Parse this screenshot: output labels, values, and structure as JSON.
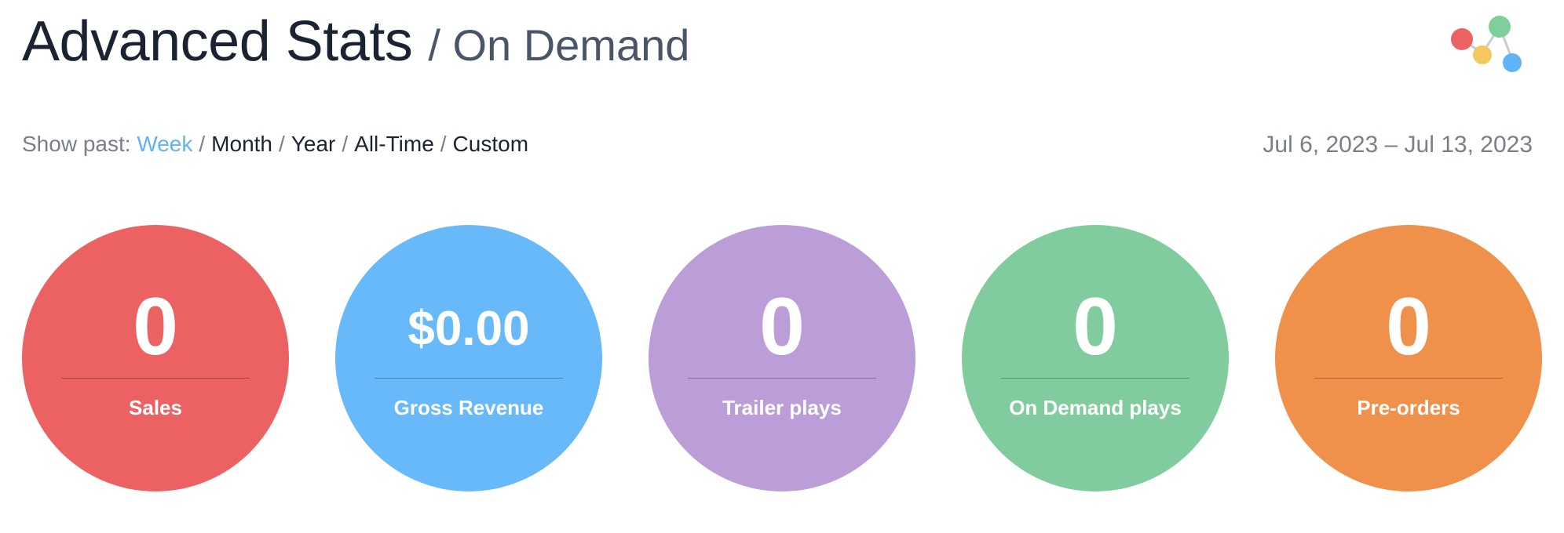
{
  "header": {
    "title": "Advanced Stats",
    "subtitle": "/ On Demand"
  },
  "logo": {
    "icon": "network-nodes-logo",
    "colors": [
      "#ec6263",
      "#f5c85e",
      "#7fcf9c",
      "#5fb4f7"
    ]
  },
  "filter": {
    "prefix": "Show past:",
    "options": [
      {
        "label": "Week",
        "active": true
      },
      {
        "label": "Month",
        "active": false
      },
      {
        "label": "Year",
        "active": false
      },
      {
        "label": "All-Time",
        "active": false
      },
      {
        "label": "Custom",
        "active": false
      }
    ],
    "separator": "/",
    "active_color": "#5fb4f1"
  },
  "date_range": "Jul 6, 2023 – Jul 13, 2023",
  "stats": [
    {
      "value": "0",
      "label": "Sales",
      "color": "#ec6263"
    },
    {
      "value": "$0.00",
      "label": "Gross Revenue",
      "color": "#67b9fa"
    },
    {
      "value": "0",
      "label": "Trailer plays",
      "color": "#bb9ed8"
    },
    {
      "value": "0",
      "label": "On Demand plays",
      "color": "#81cc9e"
    },
    {
      "value": "0",
      "label": "Pre-orders",
      "color": "#ef904b"
    }
  ]
}
